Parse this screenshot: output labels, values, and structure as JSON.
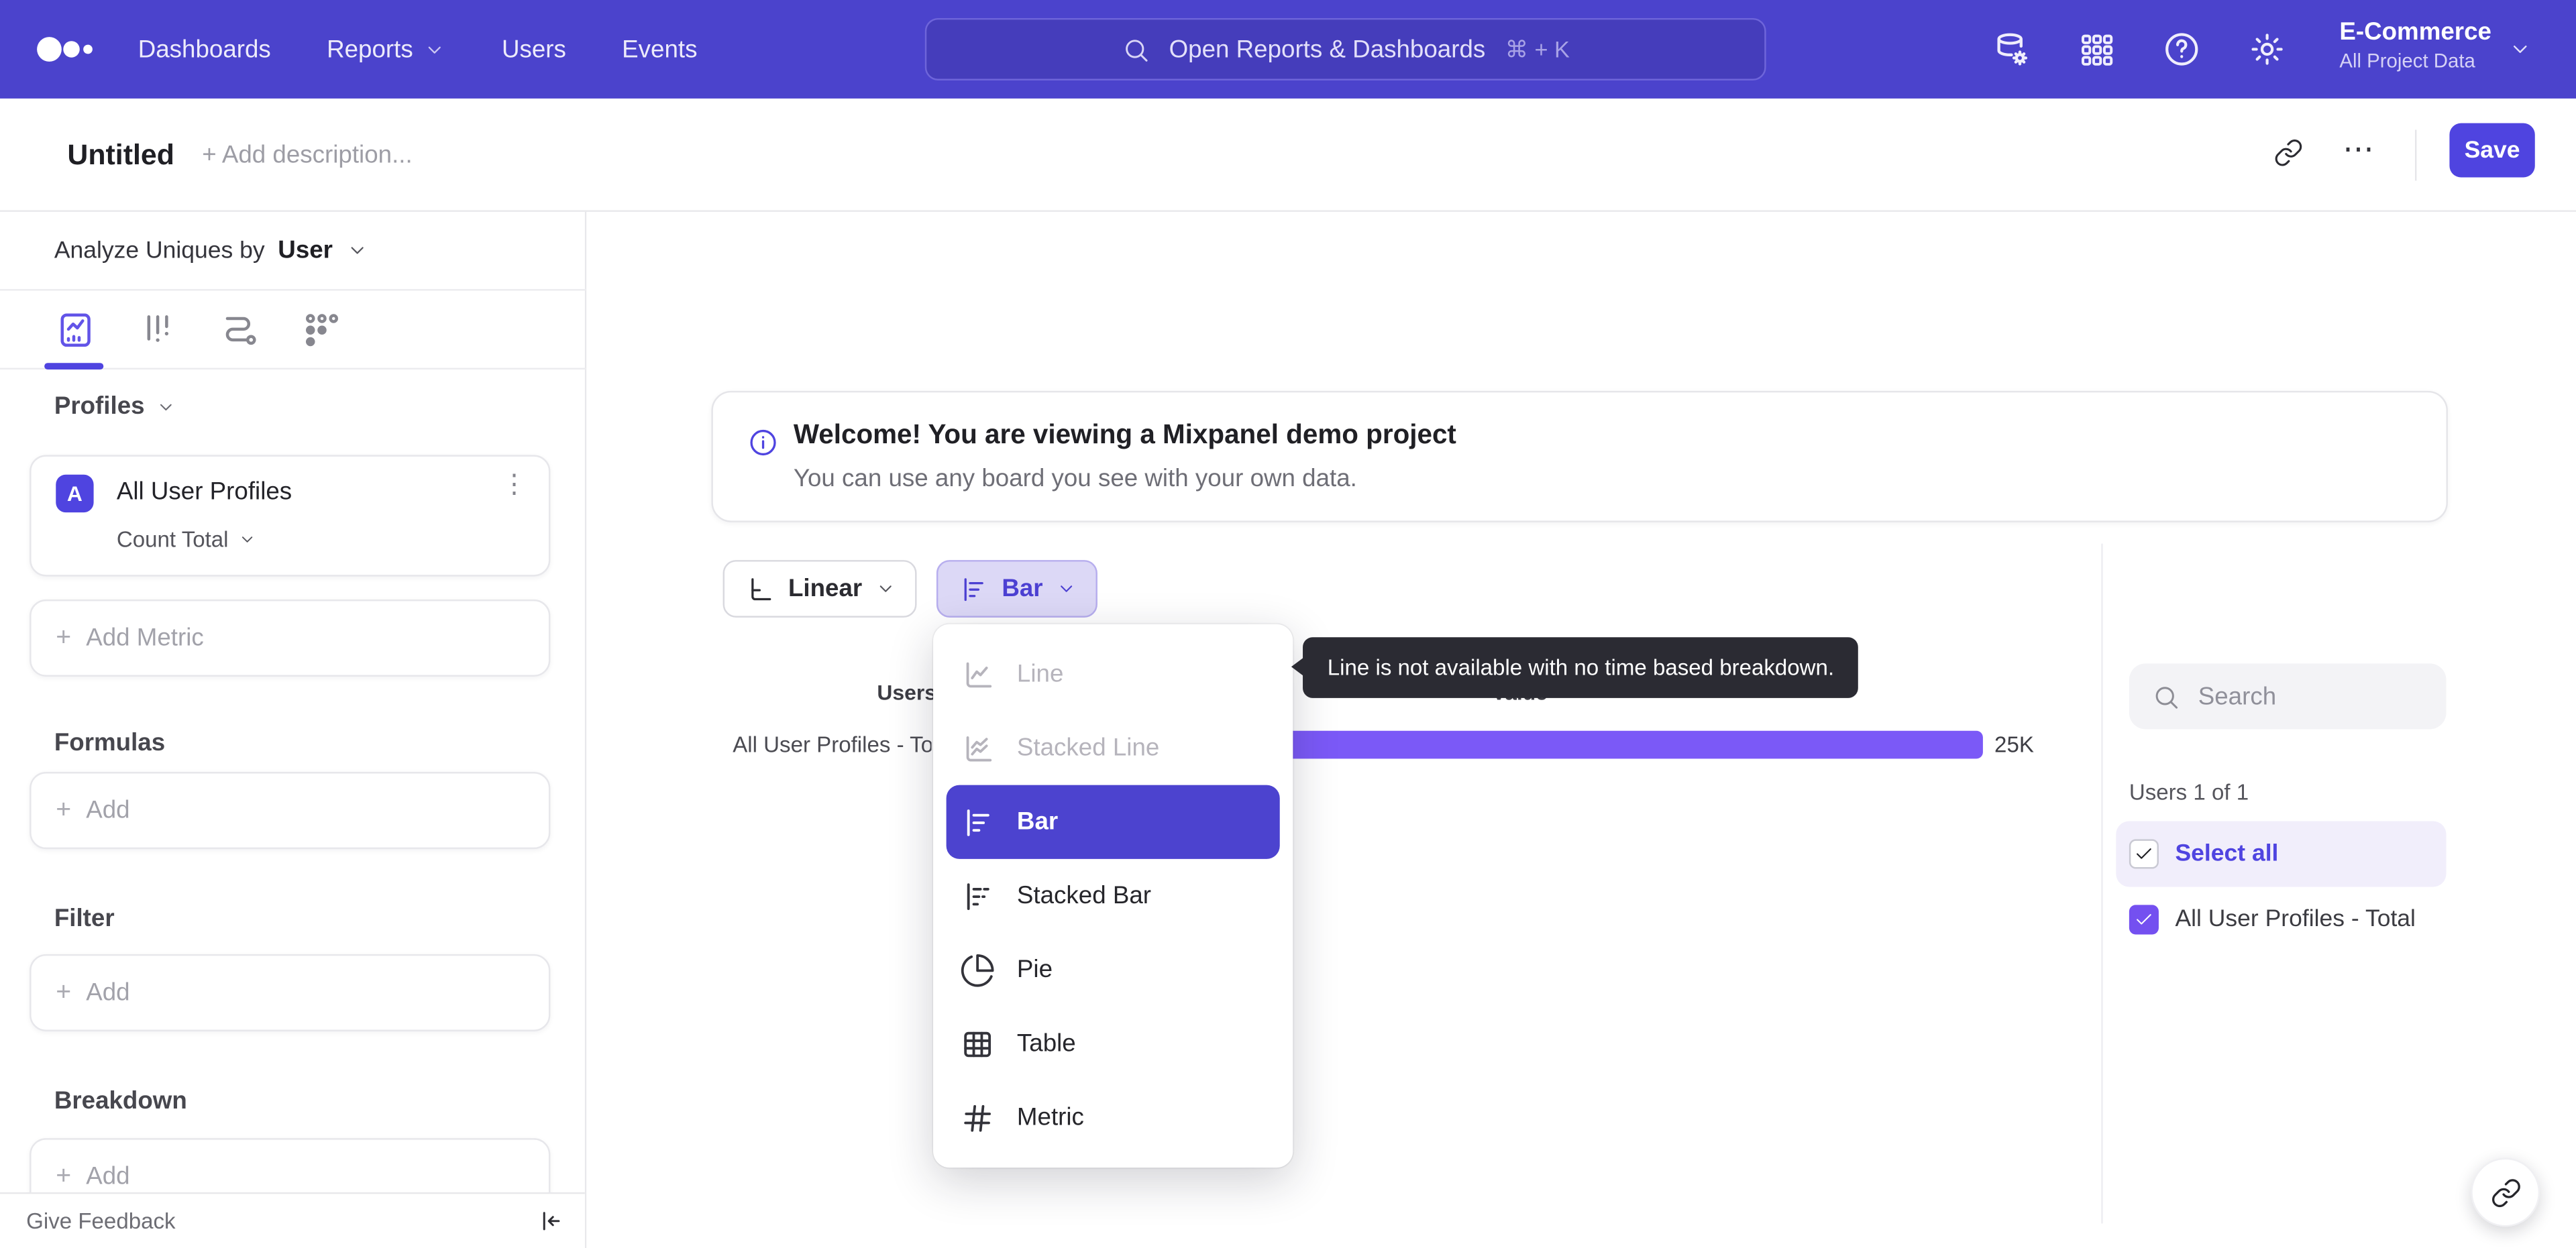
{
  "colors": {
    "topnav_bg": "#4b43cc",
    "accent": "#4f44e0",
    "bar_fill": "#7b59f7",
    "selected_menu_item_bg": "#4c43cf",
    "tooltip_bg": "#2b2b33",
    "select_all_row_bg": "#f1eefb",
    "chart_type_button_bg": "#dcd8f6"
  },
  "icons": {
    "command_k": "⌘ + K",
    "kebab": "⋮",
    "ellipsis": "⋯",
    "plus": "+"
  },
  "topnav": {
    "nav": [
      "Dashboards",
      "Reports",
      "Users",
      "Events"
    ],
    "search_placeholder": "Open Reports & Dashboards",
    "project_name": "E-Commerce",
    "project_scope": "All Project Data"
  },
  "header": {
    "title": "Untitled",
    "description_placeholder": "+ Add description...",
    "save_label": "Save"
  },
  "sidebar": {
    "analyze_prefix": "Analyze Uniques by",
    "analyze_entity": "User",
    "profiles_heading": "Profiles",
    "metric_badge": "A",
    "metric_name": "All User Profiles",
    "metric_aggregation": "Count Total",
    "add_metric_label": "Add Metric",
    "formulas_heading": "Formulas",
    "filter_heading": "Filter",
    "breakdown_heading": "Breakdown",
    "add_label": "Add",
    "give_feedback_label": "Give Feedback"
  },
  "banner": {
    "title": "Welcome! You are viewing a Mixpanel demo project",
    "subtitle": "You can use any board you see with your own data."
  },
  "controls": {
    "scale_label": "Linear",
    "chart_type_label": "Bar"
  },
  "chart_menu": {
    "items": [
      {
        "label": "Line",
        "state": "disabled"
      },
      {
        "label": "Stacked Line",
        "state": "disabled"
      },
      {
        "label": "Bar",
        "state": "selected"
      },
      {
        "label": "Stacked Bar",
        "state": "default"
      },
      {
        "label": "Pie",
        "state": "default"
      },
      {
        "label": "Table",
        "state": "default"
      },
      {
        "label": "Metric",
        "state": "default"
      }
    ],
    "tooltip": "Line is not available with no time based breakdown."
  },
  "chart_data": {
    "type": "bar",
    "orientation": "horizontal",
    "col_headers": [
      "Users",
      "Value"
    ],
    "categories": [
      "All User Profiles - Total"
    ],
    "values": [
      25000
    ],
    "value_labels": [
      "25K"
    ],
    "bar_color": "#7b59f7"
  },
  "right_panel": {
    "search_placeholder": "Search",
    "count_label": "Users 1 of 1",
    "select_all_label": "Select all",
    "series": [
      {
        "label": "All User Profiles - Total",
        "checked": true
      }
    ]
  }
}
